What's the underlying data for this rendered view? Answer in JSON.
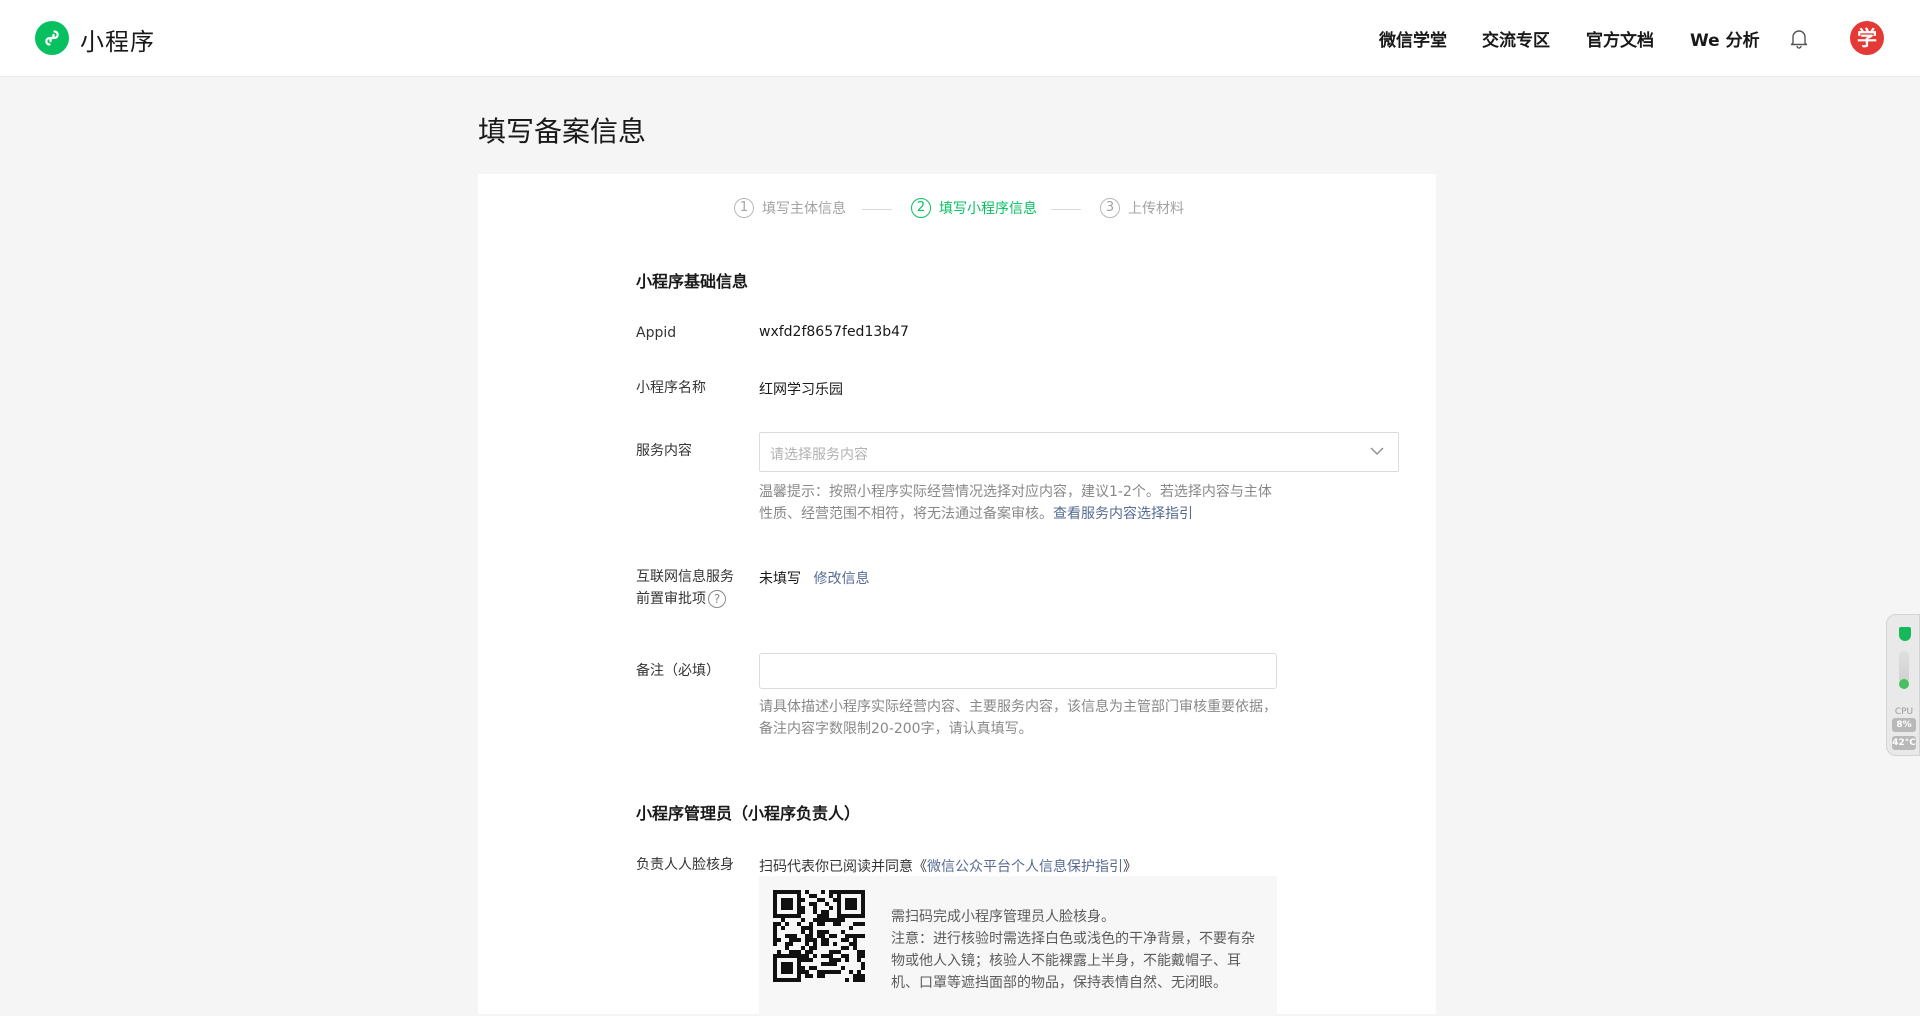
{
  "header": {
    "logo_text": "小程序",
    "nav": [
      "微信学堂",
      "交流专区",
      "官方文档",
      "We 分析"
    ],
    "avatar_text": "学"
  },
  "page_title": "填写备案信息",
  "steps": [
    {
      "num": "1",
      "label": "填写主体信息",
      "state": "done"
    },
    {
      "num": "2",
      "label": "填写小程序信息",
      "state": "active"
    },
    {
      "num": "3",
      "label": "上传材料",
      "state": "pending"
    }
  ],
  "basic": {
    "section_title": "小程序基础信息",
    "appid_label": "Appid",
    "appid_value": "wxfd2f8657fed13b47",
    "name_label": "小程序名称",
    "name_value": "红网学习乐园",
    "service_label": "服务内容",
    "service_placeholder": "请选择服务内容",
    "service_hint_1": "温馨提示：按照小程序实际经营情况选择对应内容，建议1-2个。若选择内容与主体",
    "service_hint_2": "性质、经营范围不相符，将无法通过备案审核。",
    "service_hint_link": "查看服务内容选择指引",
    "approval_label_1": "互联网信息服务",
    "approval_label_2": "前置审批项",
    "approval_help": "?",
    "approval_value": "未填写",
    "approval_link": "修改信息",
    "remark_label": "备注（必填）",
    "remark_value": "",
    "remark_hint_1": "请具体描述小程序实际经营内容、主要服务内容，该信息为主管部门审核重要依据，",
    "remark_hint_2": "备注内容字数限制20-200字，请认真填写。"
  },
  "admin": {
    "section_title": "小程序管理员（小程序负责人）",
    "face_label": "负责人人脸核身",
    "agree_text": "扫码代表你已阅读并同意《",
    "agree_link": "微信公众平台个人信息保护指引",
    "agree_close": "》",
    "qr_text_1": "需扫码完成小程序管理员人脸核身。",
    "qr_text_2": "注意：进行核验时需选择白色或浅色的干净背景，不要有杂物或他人入镜；核验人不能裸露上半身，不能戴帽子、耳机、口罩等遮挡面部的物品，保持表情自然、无闭眼。"
  },
  "side_widget": {
    "label": "CPU",
    "cpu": "8%",
    "temp": "42°C"
  },
  "colors": {
    "brand_green": "#07c160",
    "link_blue": "#576b95",
    "avatar_red": "#e53935"
  }
}
